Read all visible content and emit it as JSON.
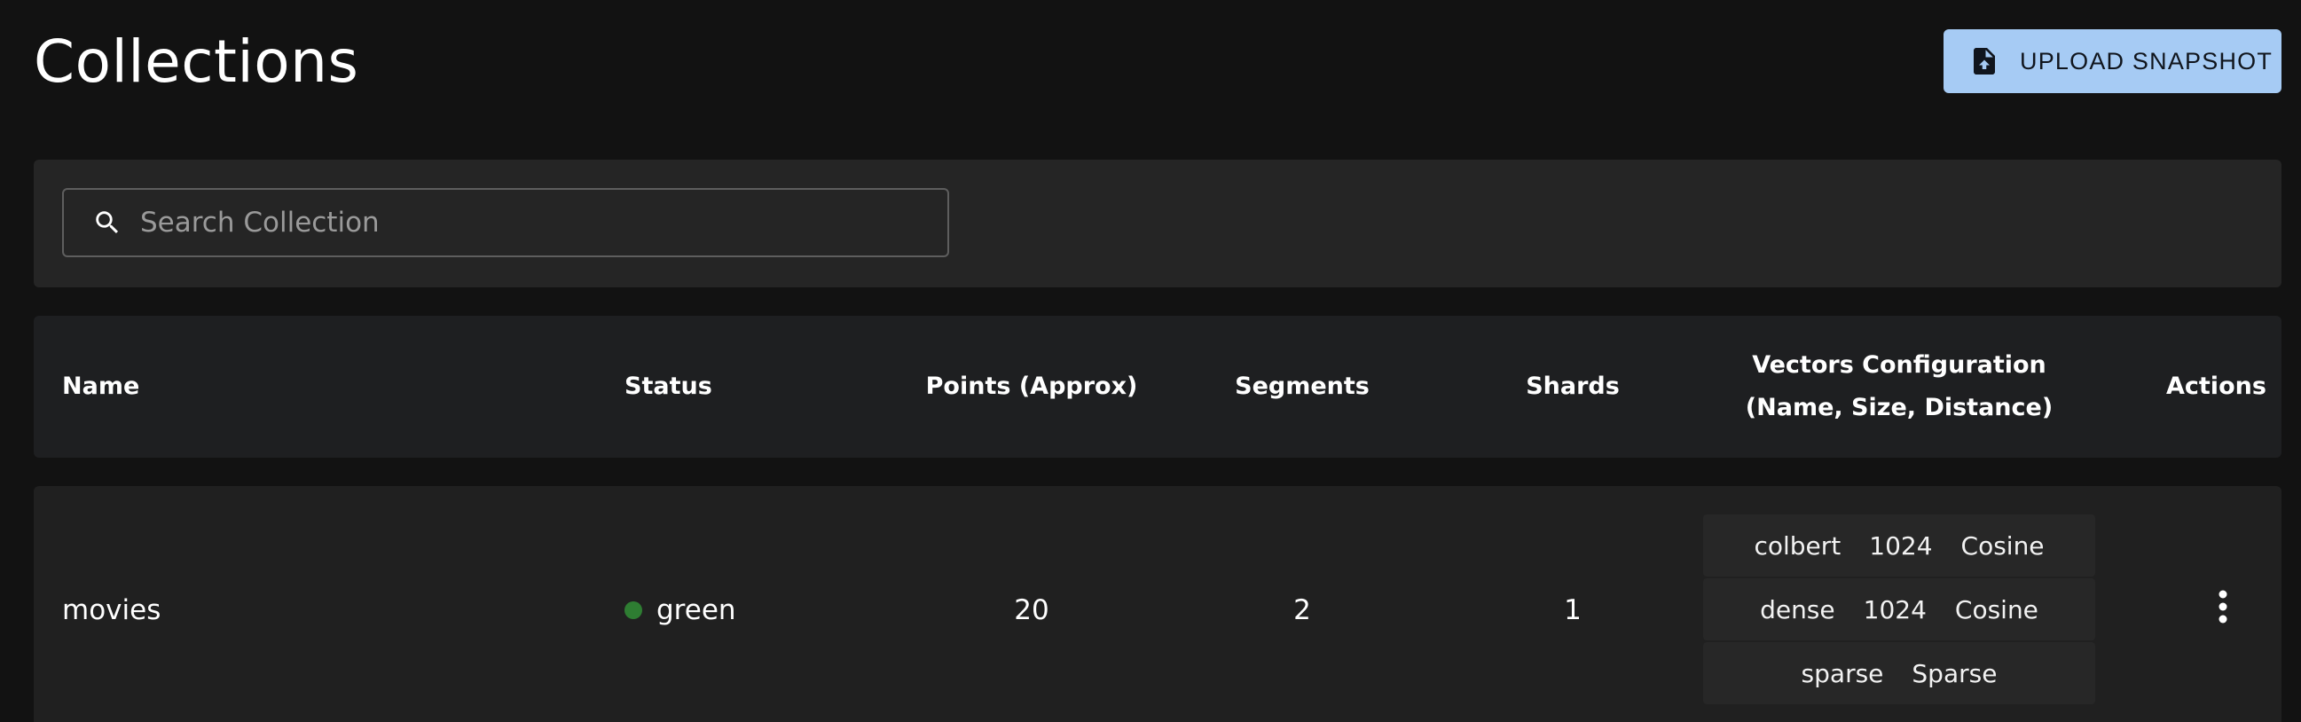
{
  "page": {
    "title": "Collections"
  },
  "toolbar": {
    "upload_label": "UPLOAD SNAPSHOT",
    "upload_icon": "file-upload-icon",
    "accent_color": "#a6cbf4"
  },
  "search": {
    "placeholder": "Search Collection",
    "value": "",
    "icon": "search-icon"
  },
  "table": {
    "headers": {
      "name": "Name",
      "status": "Status",
      "points": "Points (Approx)",
      "segments": "Segments",
      "shards": "Shards",
      "vectors_line1": "Vectors Configuration",
      "vectors_line2": "(Name, Size, Distance)",
      "actions": "Actions"
    },
    "rows": [
      {
        "name": "movies",
        "status": "green",
        "status_color": "#2e7d32",
        "points": "20",
        "segments": "2",
        "shards": "1",
        "vectors": [
          {
            "name": "colbert",
            "size": "1024",
            "distance": "Cosine"
          },
          {
            "name": "dense",
            "size": "1024",
            "distance": "Cosine"
          },
          {
            "name": "sparse",
            "distance": "Sparse"
          }
        ],
        "actions_icon": "more-vertical-icon"
      }
    ]
  }
}
